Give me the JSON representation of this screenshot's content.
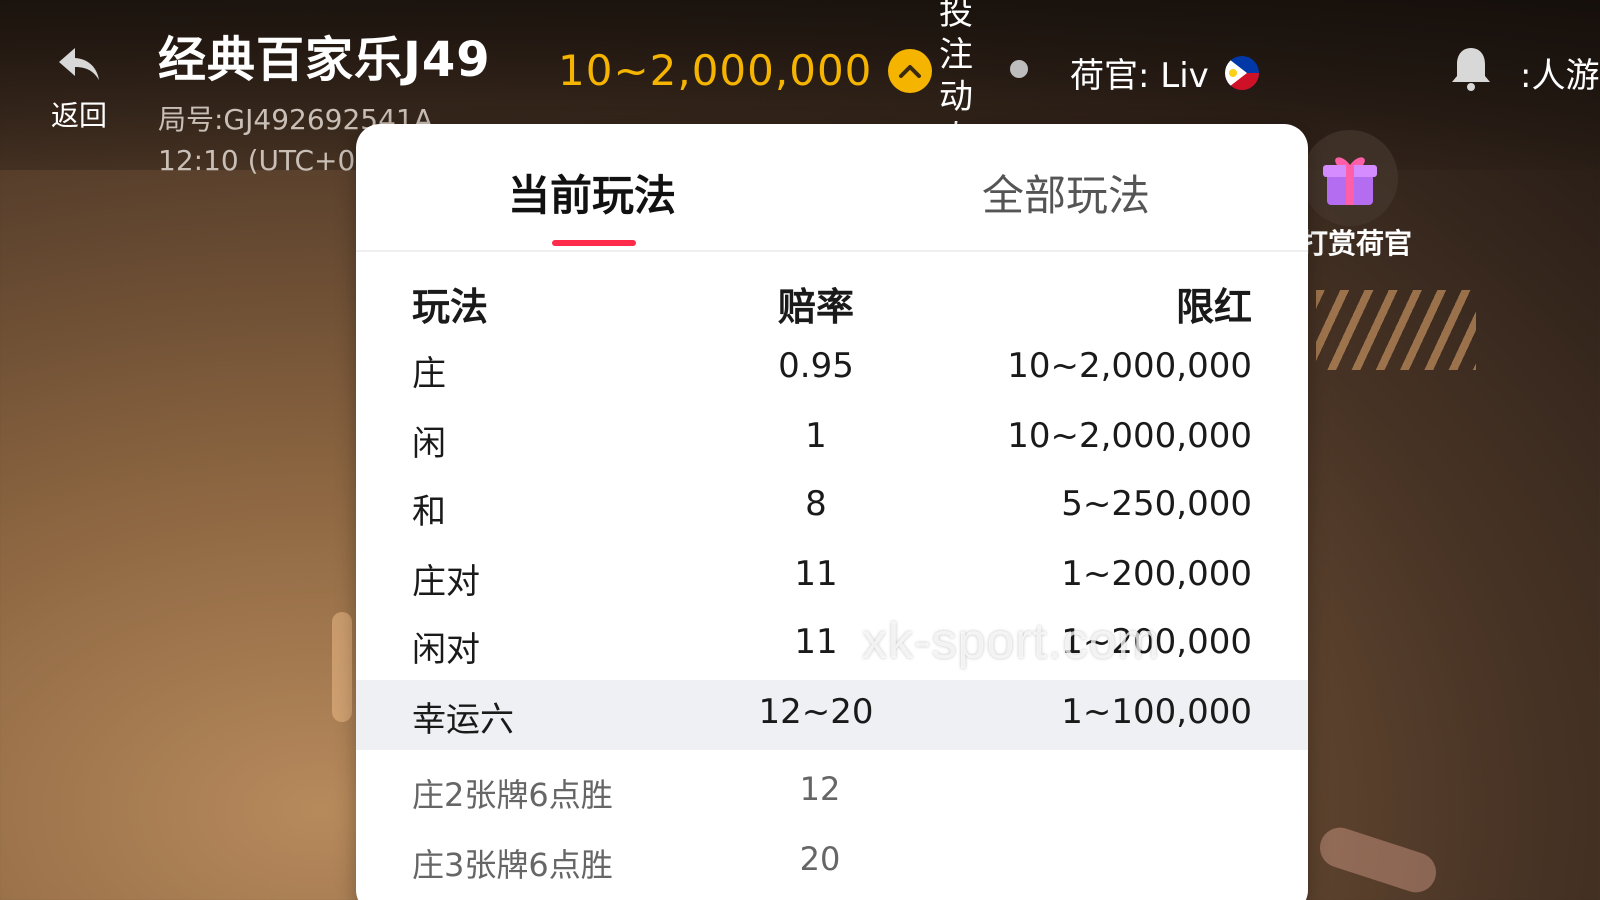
{
  "header": {
    "back_label": "返回",
    "title": "经典百家乐J49",
    "round_number": "局号:GJ492692541A",
    "time": "12:10 (UTC+0",
    "limit_range": "10~2,000,000",
    "bet_animation": "投注动态",
    "dealer": "荷官: Liv",
    "players_label": ":人游",
    "accent_color": "#f5b400"
  },
  "gift": {
    "label": "打赏荷官"
  },
  "panel": {
    "tabs": [
      {
        "label": "当前玩法",
        "active": true
      },
      {
        "label": "全部玩法",
        "active": false
      }
    ],
    "columns": {
      "play": "玩法",
      "odds": "赔率",
      "limit": "限红"
    },
    "rows": [
      {
        "play": "庄",
        "odds": "0.95",
        "limit": "10~2,000,000"
      },
      {
        "play": "闲",
        "odds": "1",
        "limit": "10~2,000,000"
      },
      {
        "play": "和",
        "odds": "8",
        "limit": "5~250,000"
      },
      {
        "play": "庄对",
        "odds": "11",
        "limit": "1~200,000"
      },
      {
        "play": "闲对",
        "odds": "11",
        "limit": "1~200,000"
      },
      {
        "play": "幸运六",
        "odds": "12~20",
        "limit": "1~100,000"
      }
    ],
    "sub_rows": [
      {
        "play": "庄2张牌6点胜",
        "odds": "12"
      },
      {
        "play": "庄3张牌6点胜",
        "odds": "20"
      }
    ],
    "tab_indicator_color": "#ff2b4a"
  },
  "watermark": "xk-sport.com"
}
